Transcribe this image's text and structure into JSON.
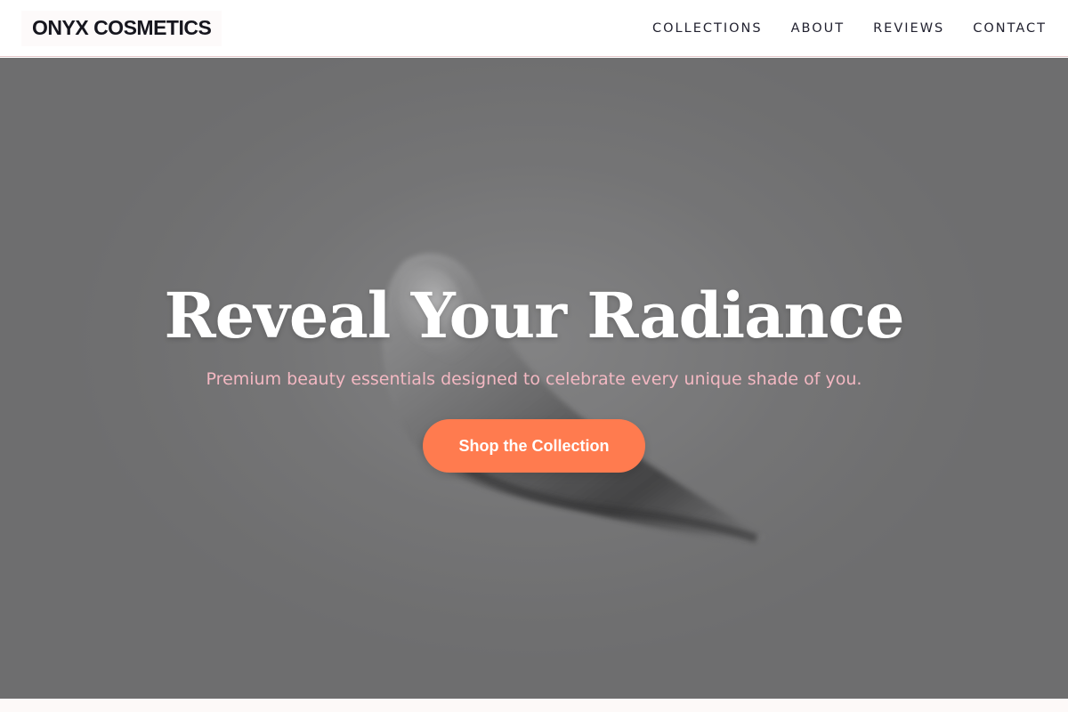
{
  "header": {
    "brand": "ONYX COSMETICS",
    "nav": [
      "COLLECTIONS",
      "ABOUT",
      "REVIEWS",
      "CONTACT"
    ]
  },
  "hero": {
    "title": "Reveal Your Radiance",
    "subtitle": "Premium beauty essentials designed to celebrate every unique shade of you.",
    "cta_label": "Shop the Collection",
    "background_image": "grayscale-cosmetic-swatch"
  },
  "colors": {
    "brand_text": "#16161e",
    "nav_border": "#e6c9cb",
    "subtitle": "#f3b8c2",
    "cta": "#ff7b4f",
    "hero_background": "#787878"
  }
}
